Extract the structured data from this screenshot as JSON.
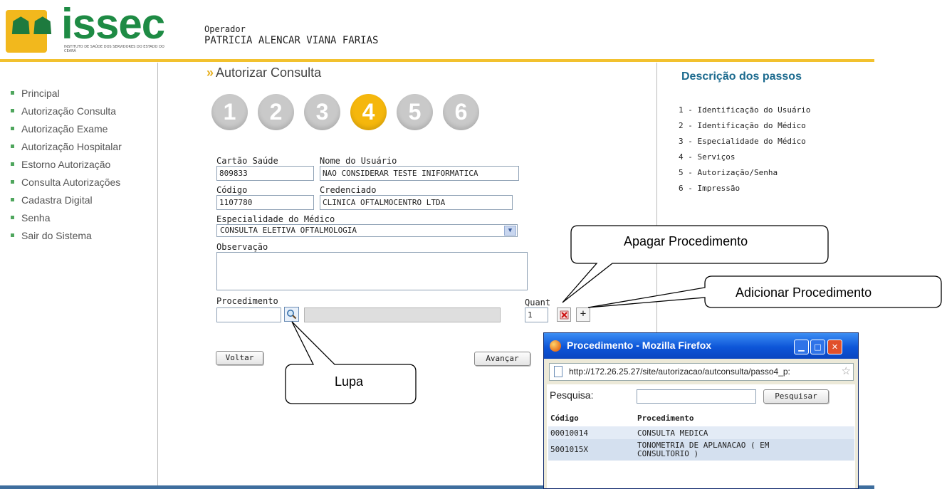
{
  "header": {
    "logo_text": "issec",
    "logo_subtitle": "INSTITUTO DE SAÚDE DOS SERVIDORES DO ESTADO DO CEARÁ",
    "operator_label": "Operador",
    "operator_name": "PATRICIA ALENCAR VIANA FARIAS"
  },
  "nav": {
    "items": [
      {
        "label": "Principal"
      },
      {
        "label": "Autorização Consulta"
      },
      {
        "label": "Autorização Exame"
      },
      {
        "label": "Autorização Hospitalar"
      },
      {
        "label": "Estorno Autorização"
      },
      {
        "label": "Consulta Autorizações"
      },
      {
        "label": "Cadastra Digital"
      },
      {
        "label": "Senha"
      },
      {
        "label": "Sair do Sistema"
      }
    ]
  },
  "main": {
    "title": "Autorizar Consulta",
    "steps": [
      "1",
      "2",
      "3",
      "4",
      "5",
      "6"
    ],
    "active_step": 4,
    "fields": {
      "cartao_label": "Cartão Saúde",
      "cartao_value": "809833",
      "nome_label": "Nome do Usuário",
      "nome_value": "NAO CONSIDERAR TESTE INIFORMATICA",
      "codigo_label": "Código",
      "codigo_value": "1107780",
      "credenciado_label": "Credenciado",
      "credenciado_value": "CLINICA OFTALMOCENTRO LTDA",
      "especialidade_label": "Especialidade do Médico",
      "especialidade_value": "CONSULTA ELETIVA OFTALMOLOGIA",
      "observacao_label": "Observação",
      "procedimento_label": "Procedimento",
      "quant_label": "Quant",
      "quant_value": "1"
    },
    "buttons": {
      "voltar": "Voltar",
      "avancar": "Avançar",
      "add_symbol": "+"
    }
  },
  "steps_panel": {
    "title": "Descrição dos passos",
    "items": [
      "1 - Identificação do Usuário",
      "2 - Identificação do Médico",
      "3 - Especialidade do Médico",
      "4 - Serviços",
      "5 - Autorização/Senha",
      "6 - Impressão"
    ]
  },
  "popup": {
    "title": "Procedimento - Mozilla Firefox",
    "url": "http://172.26.25.27/site/autorizacao/autconsulta/passo4_p:",
    "search_label": "Pesquisa:",
    "search_button": "Pesquisar",
    "columns": [
      "Código",
      "Procedimento"
    ],
    "rows": [
      {
        "codigo": "00010014",
        "procedimento": "CONSULTA MEDICA"
      },
      {
        "codigo": "5001015X",
        "procedimento": "TONOMETRIA DE APLANACAO ( EM CONSULTORIO )"
      }
    ]
  },
  "callouts": {
    "apagar": "Apagar Procedimento",
    "adicionar": "Adicionar Procedimento",
    "lupa": "Lupa"
  },
  "colors": {
    "brand_green": "#1e8b44",
    "brand_yellow": "#f2c12e",
    "active_step": "#f5b70d",
    "title_blue": "#1b6a8e"
  }
}
